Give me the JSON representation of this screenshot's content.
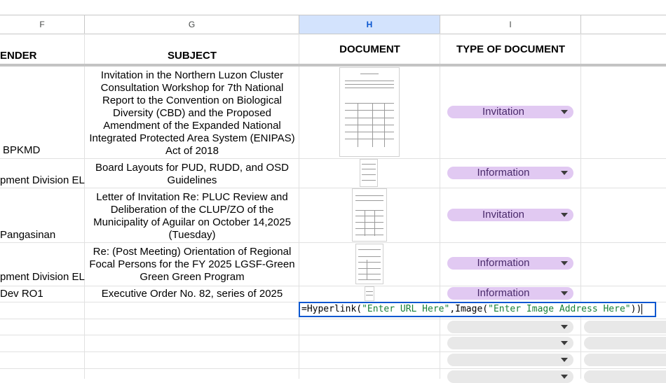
{
  "columns": [
    {
      "letter": "F",
      "header": "ENDER"
    },
    {
      "letter": "G",
      "header": "SUBJECT"
    },
    {
      "letter": "H",
      "header": "DOCUMENT"
    },
    {
      "letter": "I",
      "header": "TYPE OF DOCUMENT"
    }
  ],
  "rows": [
    {
      "sender": "BPKMD",
      "subject": "Invitation in the Northern Luzon Cluster Consultation Workshop for 7th National Report to the Convention on Biological Diversity (CBD) and the Proposed Amendment of the Expanded National Integrated Protected Area System (ENIPAS) Act of 2018",
      "type": "Invitation"
    },
    {
      "sender": "pment Division EL",
      "subject": "Board Layouts for PUD, RUDD, and OSD Guidelines",
      "type": "Information"
    },
    {
      "sender": "Pangasinan",
      "subject": "Letter of Invitation Re: PLUC Review and Deliberation of the CLUP/ZO of the Municipality of Aguilar on October 14,2025 (Tuesday)",
      "type": "Invitation"
    },
    {
      "sender": "pment Division EL",
      "subject": "Re: (Post Meeting) Orientation of Regional Focal Persons for the FY 2025 LGSF-Green Green Green Program",
      "type": "Information"
    },
    {
      "sender": "Dev RO1",
      "subject": "Executive Order No. 82, series of 2025",
      "type": "Information"
    }
  ],
  "formula": {
    "prefix": "=Hyperlink(",
    "arg1": "\"Enter URL Here\"",
    "mid": ",Image(",
    "arg2": "\"Enter Image Address Here\"",
    "suffix": "))"
  },
  "colors": {
    "selected_header": "#d3e3fd",
    "chip": "#e1c9f2",
    "edit_border": "#0b57d0",
    "string": "#188038"
  }
}
